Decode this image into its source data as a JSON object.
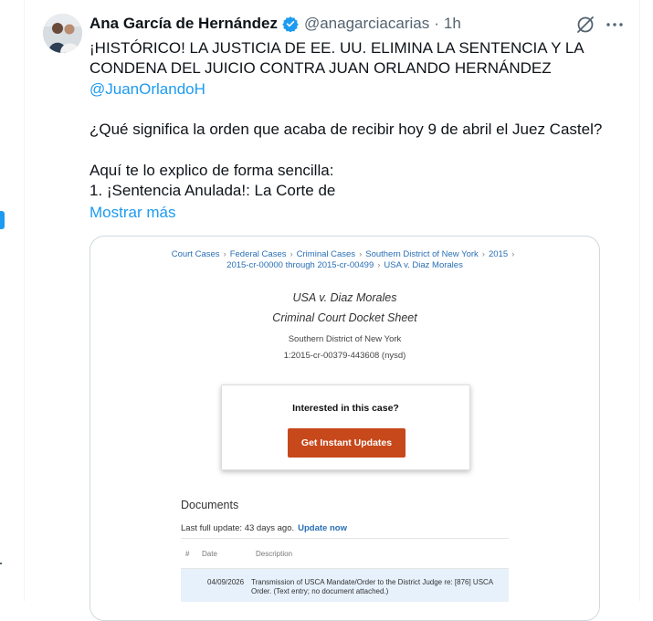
{
  "tweet": {
    "author": "Ana García de Hernández",
    "handle": "@anagarciacarias",
    "separator": "·",
    "time": "1h",
    "lines": [
      "¡HISTÓRICO! LA JUSTICIA DE EE. UU. ELIMINA LA SENTENCIA Y LA CONDENA DEL JUICIO CONTRA JUAN ORLANDO HERNÁNDEZ",
      "@JuanOrlandoH",
      "¿Qué significa la orden que acaba de recibir hoy 9 de abril el Juez Castel?",
      "Aquí te lo explico de forma sencilla:",
      "1. ¡Sentencia Anulada!: La Corte de"
    ],
    "show_more": "Mostrar más"
  },
  "document": {
    "breadcrumbs": [
      "Court Cases",
      "Federal Cases",
      "Criminal Cases",
      "Southern District of New York",
      "2015",
      "2015-cr-00000 through 2015-cr-00499",
      "USA v. Diaz Morales"
    ],
    "breadcrumb_separator": "›",
    "case_title": "USA v. Diaz Morales",
    "subtitle": "Criminal Court Docket Sheet",
    "court": "Southern District of New York",
    "docket_number": "1:2015-cr-00379-443608 (nysd)",
    "interest_question": "Interested in this case?",
    "cta_label": "Get Instant Updates",
    "documents_heading": "Documents",
    "last_update_text": "Last full update: 43 days ago.",
    "update_link": "Update now",
    "table": {
      "headers": [
        "#",
        "Date",
        "Description"
      ],
      "rows": [
        {
          "date": "04/09/2026",
          "description": "Transmission of USCA Mandate/Order to the District Judge re: [876] USCA Order. (Text entry; no document attached.)"
        }
      ]
    }
  },
  "colors": {
    "link": "#1d9bf0",
    "verified": "#1d9bf0",
    "cta_bg": "#c7481b",
    "doc_link": "#2a6fb5"
  }
}
